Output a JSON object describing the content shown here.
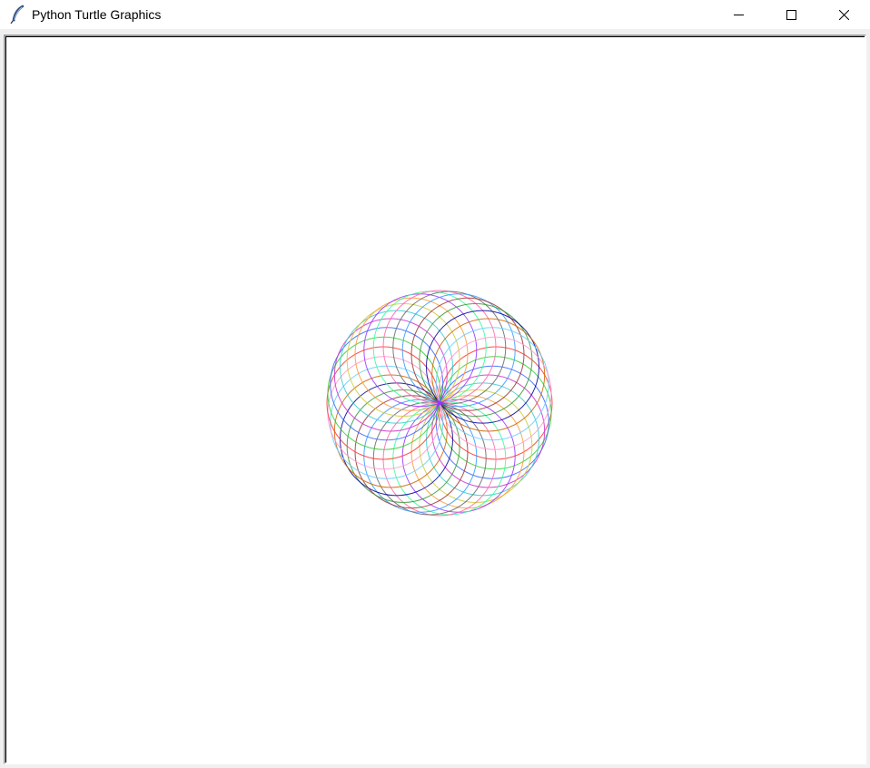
{
  "window": {
    "title": "Python Turtle Graphics",
    "app_icon": "feather-icon",
    "controls": {
      "minimize": "minimize-icon",
      "maximize": "maximize-icon",
      "close": "close-icon"
    }
  },
  "canvas": {
    "background": "#ffffff",
    "drawing": {
      "kind": "spirograph",
      "circle_count": 36,
      "colors": [
        "#ff3333",
        "#33cc33",
        "#3366ff",
        "#cc33cc",
        "#33cccc",
        "#cccc33",
        "#ff9933",
        "#9933ff",
        "#33ff99",
        "#ff66aa",
        "#666666",
        "#3399ff",
        "#993333",
        "#339933",
        "#000099",
        "#cc6600",
        "#66ccff",
        "#ff99cc"
      ]
    }
  }
}
